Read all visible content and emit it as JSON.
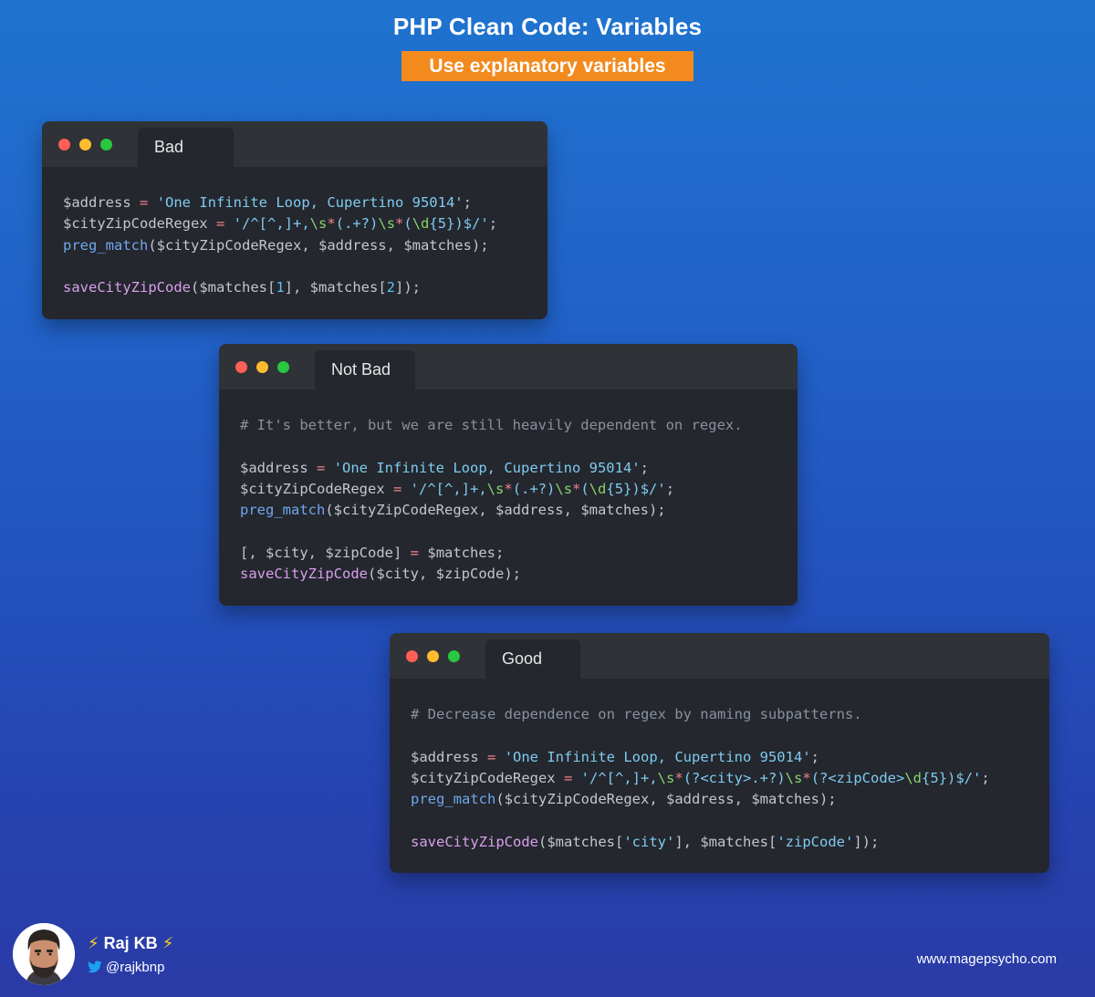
{
  "header": {
    "title": "PHP Clean Code: Variables",
    "subtitle": "Use explanatory variables"
  },
  "windows": [
    {
      "tab": "Bad"
    },
    {
      "tab": "Not Bad",
      "comment": "# It's better, but we are still heavily dependent on regex."
    },
    {
      "tab": "Good",
      "comment": "# Decrease dependence on regex by naming subpatterns."
    }
  ],
  "code": {
    "var_address": "$address",
    "var_regex": "$cityZipCodeRegex",
    "var_matches": "$matches",
    "var_city": "$city",
    "var_zip": "$zipCode",
    "str_address": "'One Infinite Loop, Cupertino 95014'",
    "fn_preg_match": "preg_match",
    "fn_save": "saveCityZipCode",
    "num_1": "1",
    "num_2": "2",
    "str_city": "'city'",
    "str_zip": "'zipCode'",
    "cg_city": "(?<city>",
    "cg_zip": "(?<zipCode>"
  },
  "footer": {
    "author": "Raj KB",
    "handle": "@rajkbnp",
    "website": "www.magepsycho.com"
  },
  "colors": {
    "accent": "#f28a1e",
    "window_bg": "#24272e",
    "titlebar_bg": "#2f3237"
  },
  "icons": [
    "lightning-icon",
    "twitter-bird-icon",
    "avatar-portrait"
  ]
}
